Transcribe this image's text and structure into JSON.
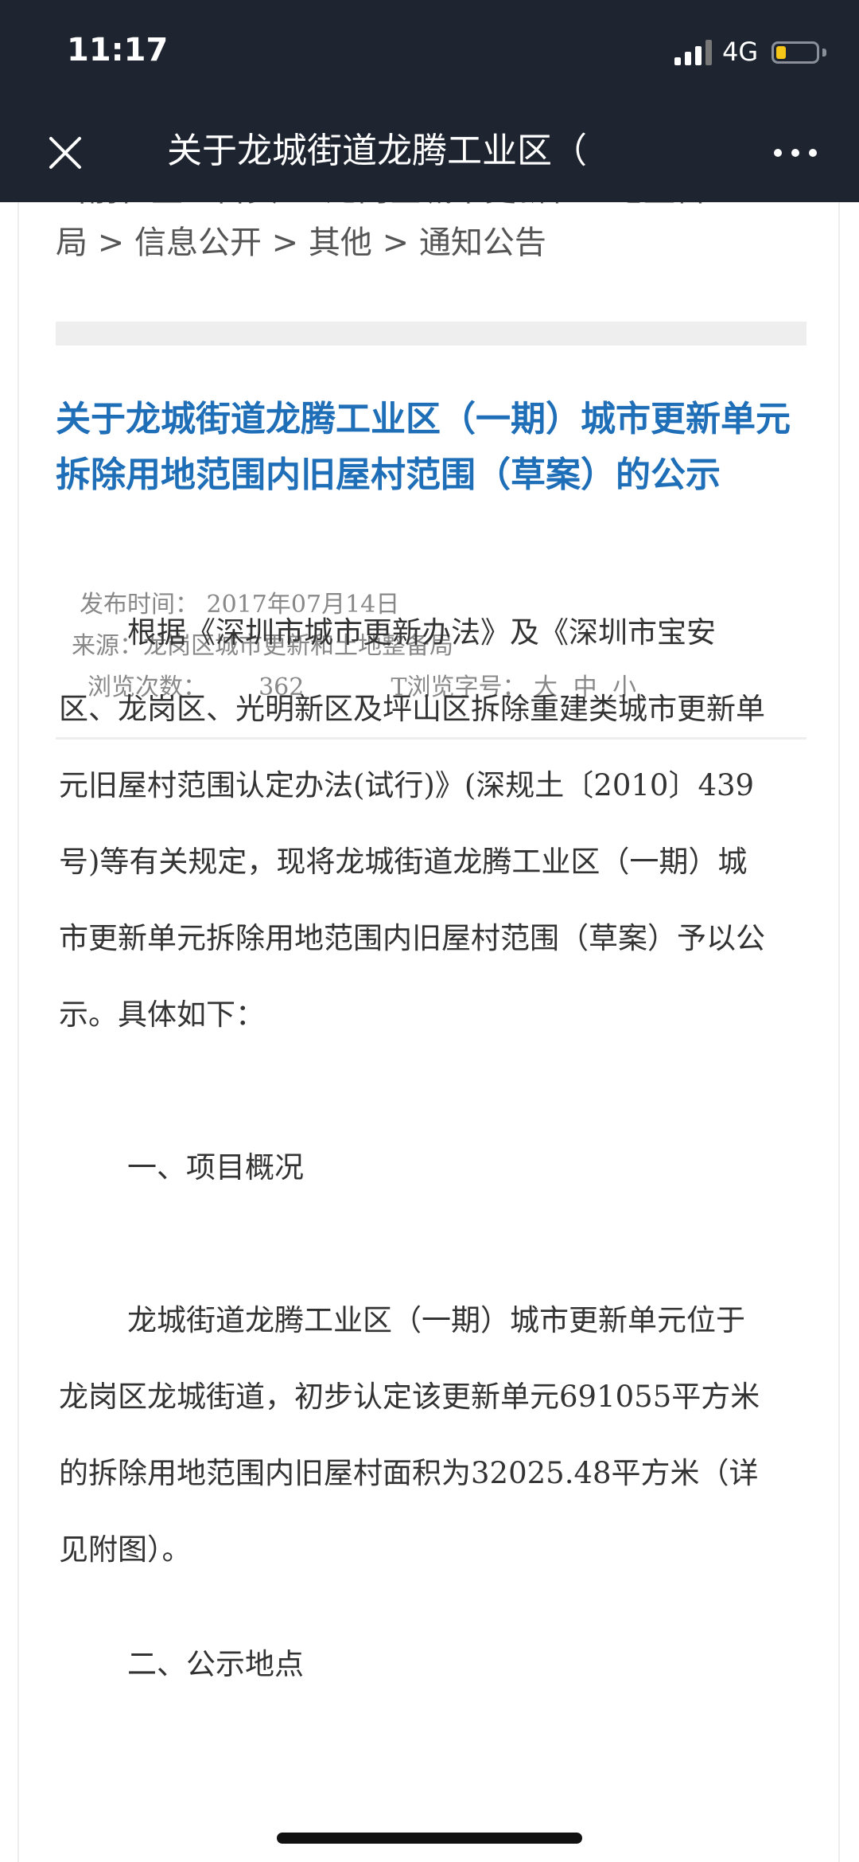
{
  "status_bar": {
    "time": "11:17",
    "network": "4G",
    "battery_level": 0.25
  },
  "nav": {
    "title": "关于龙城街道龙腾工业区（",
    "close_icon": "close-icon",
    "more_icon": "more-icon"
  },
  "breadcrumb": {
    "top_cut": "当前位置：首页 > 龙岗区城市更新和土地整备",
    "items": [
      "局",
      "信息公开",
      "其他",
      "通知公告"
    ],
    "separator": " > "
  },
  "article": {
    "title": "关于龙城街道龙腾工业区（一期）城市更新单元拆除用地范围内旧屋村范围（草案）的公示",
    "publish_label": "发布时间：",
    "publish_date": "2017年07月14日",
    "source_label": "来源：",
    "source": "龙岗区城市更新和土地整备局",
    "views_label": "浏览次数：",
    "views": "362",
    "font_size_label": "T浏览字号：",
    "font_sizes": [
      "大",
      "中",
      "小"
    ]
  },
  "content": {
    "paragraph1": "根据《深圳市城市更新办法》及《深圳市宝安区、龙岗区、光明新区及坪山区拆除重建类城市更新单元旧屋村范围认定办法(试行)》(深规土〔2010〕439号)等有关规定，现将龙城街道龙腾工业区（一期）城市更新单元拆除用地范围内旧屋村范围（草案）予以公示。具体如下：",
    "section1": "一、项目概况",
    "paragraph2": "龙城街道龙腾工业区（一期）城市更新单元位于龙岗区龙城街道，初步认定该更新单元691055平方米的拆除用地范围内旧屋村面积为32025.48平方米（详见附图）。",
    "section2_partial": "二、公示地点"
  },
  "colors": {
    "title_blue": "#1f6fb8",
    "bar_dark": "#1f2530",
    "body_text": "#333333",
    "meta_text": "#888888"
  }
}
